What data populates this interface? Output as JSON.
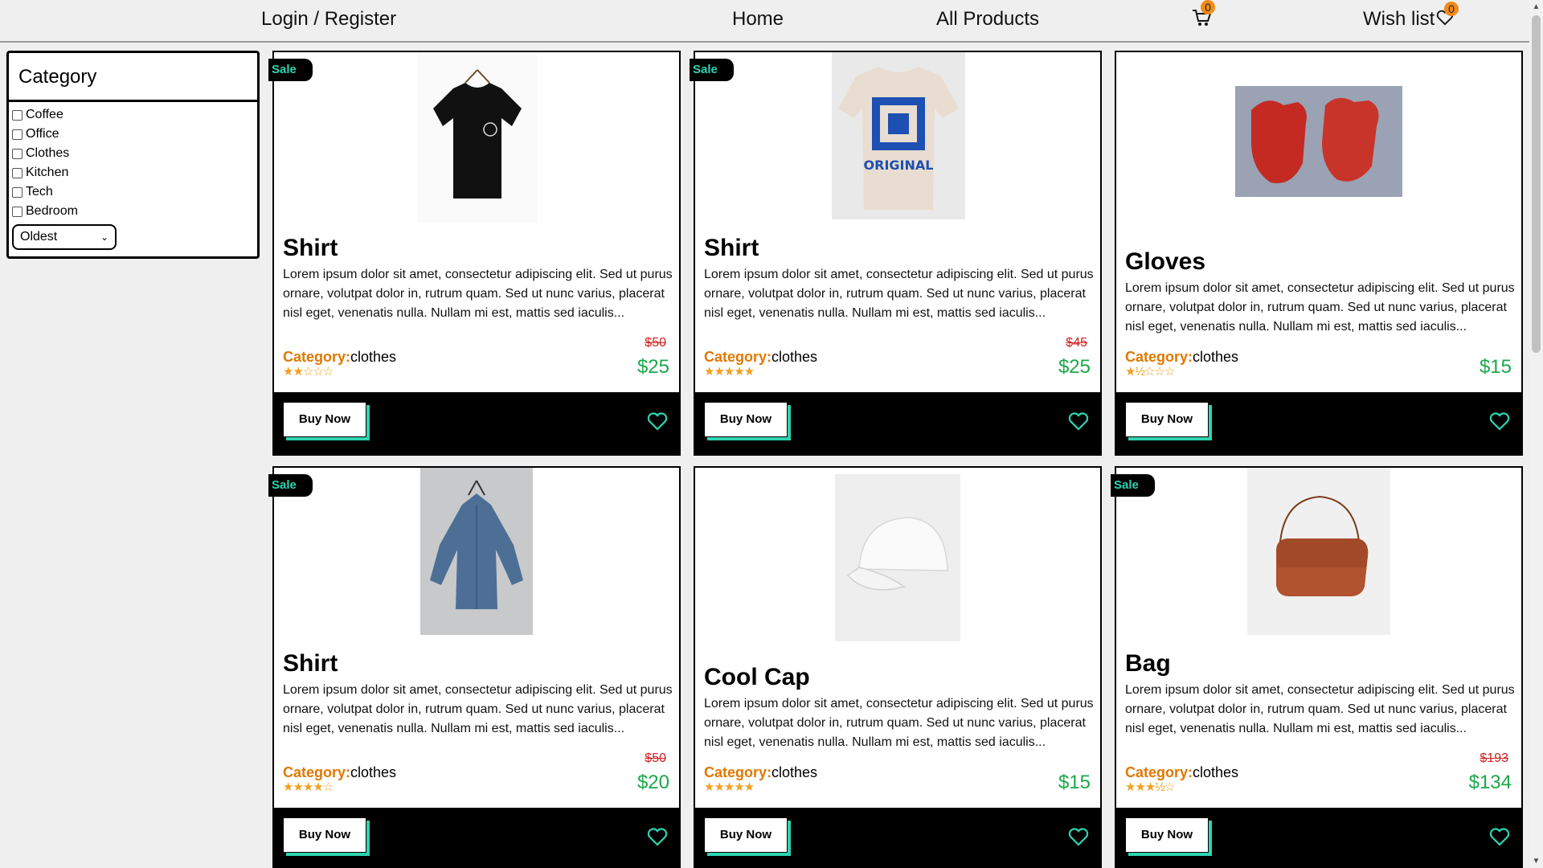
{
  "header": {
    "login": "Login / Register",
    "home": "Home",
    "all_products": "All Products",
    "cart_count": "0",
    "wishlist": "Wish list",
    "wish_count": "0"
  },
  "sidebar": {
    "title": "Category",
    "categories": [
      "Coffee",
      "Office",
      "Clothes",
      "Kitchen",
      "Tech",
      "Bedroom"
    ],
    "sort": "Oldest"
  },
  "common": {
    "category_label": "Category:",
    "buy_label": "Buy Now",
    "sale_label": "Sale",
    "description": "Lorem ipsum dolor sit amet, consectetur adipiscing elit. Sed ut purus ornare, volutpat dolor in, rutrum quam. Sed ut nunc varius, placerat nisl eget, venenatis nulla. Nullam mi est, mattis sed iaculis..."
  },
  "products": [
    {
      "name": "Shirt",
      "category": "clothes",
      "stars": "★★☆☆☆",
      "rating": 2,
      "old_price": "$50",
      "price": "$25",
      "sale": true
    },
    {
      "name": "Shirt",
      "category": "clothes",
      "stars": "★★★★★",
      "rating": 5,
      "old_price": "$45",
      "price": "$25",
      "sale": true
    },
    {
      "name": "Gloves",
      "category": "clothes",
      "stars": "★½☆☆☆",
      "rating": 1.5,
      "old_price": "",
      "price": "$15",
      "sale": false
    },
    {
      "name": "Shirt",
      "category": "clothes",
      "stars": "★★★★☆",
      "rating": 4,
      "old_price": "$50",
      "price": "$20",
      "sale": true
    },
    {
      "name": "Cool Cap",
      "category": "clothes",
      "stars": "★★★★★",
      "rating": 5,
      "old_price": "",
      "price": "$15",
      "sale": false
    },
    {
      "name": "Bag",
      "category": "clothes",
      "stars": "★★★½☆",
      "rating": 3.5,
      "old_price": "$193",
      "price": "$134",
      "sale": true
    }
  ],
  "colors": {
    "accent": "#2ed4b0",
    "category_label": "#e07800",
    "price": "#1aa84a",
    "old_price": "#d02020",
    "badge": "#f28a1a",
    "stars": "#f0a020"
  },
  "icons": [
    "cart-icon",
    "heart-icon",
    "chevron-down-icon"
  ]
}
